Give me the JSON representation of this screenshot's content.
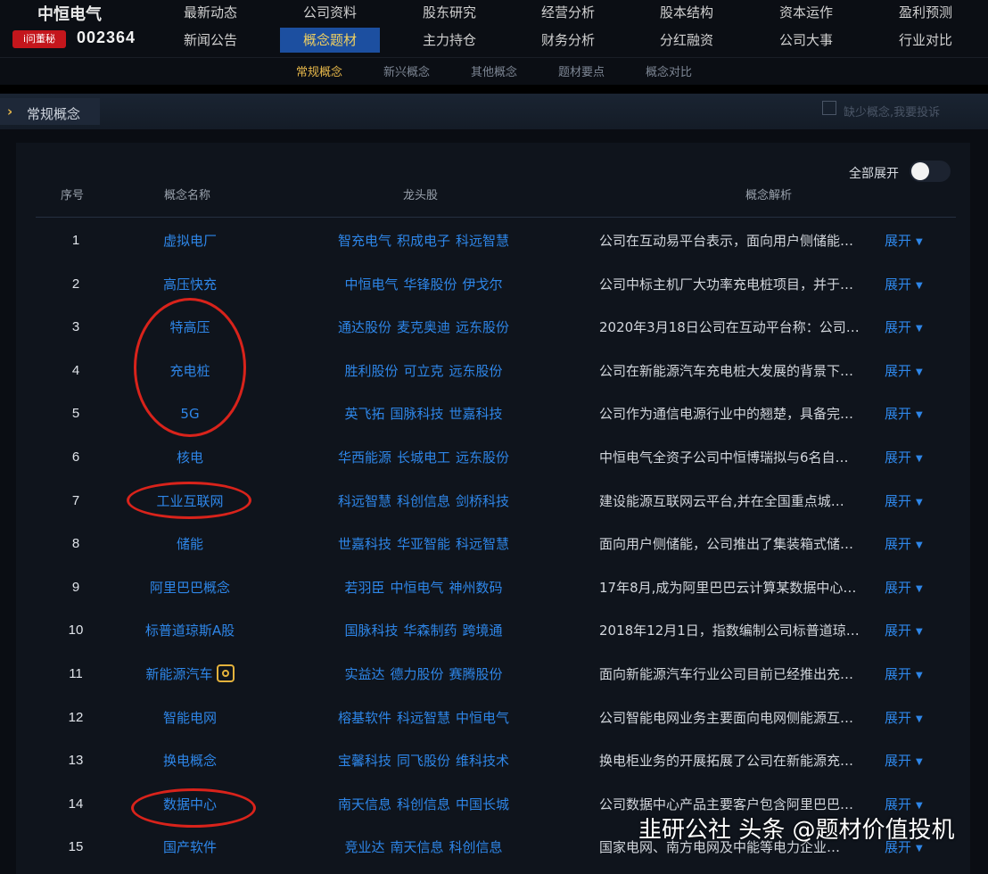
{
  "header": {
    "stock_name": "中恒电气",
    "badge": "i问董秘",
    "stock_code": "002364",
    "nav_row1": [
      "最新动态",
      "公司资料",
      "股东研究",
      "经营分析",
      "股本结构",
      "资本运作",
      "盈利预测"
    ],
    "nav_row2": [
      "新闻公告",
      "概念题材",
      "主力持仓",
      "财务分析",
      "分红融资",
      "公司大事",
      "行业对比"
    ],
    "active_nav": "概念题材"
  },
  "subnav": {
    "items": [
      "常规概念",
      "新兴概念",
      "其他概念",
      "题材要点",
      "概念对比"
    ],
    "active": "常规概念"
  },
  "section": {
    "title": "常规概念",
    "feedback": "缺少概念,我要投诉"
  },
  "table": {
    "expand_all_label": "全部展开",
    "headers": {
      "index": "序号",
      "name": "概念名称",
      "leaders": "龙头股",
      "analysis": "概念解析"
    },
    "expand_label": "展开",
    "rows": [
      {
        "idx": "1",
        "name": "虚拟电厂",
        "leaders": [
          "智充电气",
          "积成电子",
          "科远智慧"
        ],
        "desc": "公司在互动易平台表示，面向用户侧储能…"
      },
      {
        "idx": "2",
        "name": "高压快充",
        "leaders": [
          "中恒电气",
          "华锋股份",
          "伊戈尔"
        ],
        "desc": "公司中标主机厂大功率充电桩项目，并于…"
      },
      {
        "idx": "3",
        "name": "特高压",
        "leaders": [
          "通达股份",
          "麦克奥迪",
          "远东股份"
        ],
        "desc": "2020年3月18日公司在互动平台称：公司…"
      },
      {
        "idx": "4",
        "name": "充电桩",
        "leaders": [
          "胜利股份",
          "可立克",
          "远东股份"
        ],
        "desc": "公司在新能源汽车充电桩大发展的背景下…"
      },
      {
        "idx": "5",
        "name": "5G",
        "leaders": [
          "英飞拓",
          "国脉科技",
          "世嘉科技"
        ],
        "desc": "公司作为通信电源行业中的翘楚，具备完…"
      },
      {
        "idx": "6",
        "name": "核电",
        "leaders": [
          "华西能源",
          "长城电工",
          "远东股份"
        ],
        "desc": "中恒电气全资子公司中恒博瑞拟与6名自…"
      },
      {
        "idx": "7",
        "name": "工业互联网",
        "leaders": [
          "科远智慧",
          "科创信息",
          "剑桥科技"
        ],
        "desc": "建设能源互联网云平台,并在全国重点城…"
      },
      {
        "idx": "8",
        "name": "储能",
        "leaders": [
          "世嘉科技",
          "华亚智能",
          "科远智慧"
        ],
        "desc": "面向用户侧储能，公司推出了集装箱式储…"
      },
      {
        "idx": "9",
        "name": "阿里巴巴概念",
        "leaders": [
          "若羽臣",
          "中恒电气",
          "神州数码"
        ],
        "desc": "17年8月,成为阿里巴巴云计算某数据中心…"
      },
      {
        "idx": "10",
        "name": "标普道琼斯A股",
        "leaders": [
          "国脉科技",
          "华森制药",
          "跨境通"
        ],
        "desc": "2018年12月1日，指数编制公司标普道琼…"
      },
      {
        "idx": "11",
        "name": "新能源汽车",
        "leaders": [
          "实益达",
          "德力股份",
          "赛腾股份"
        ],
        "desc": "面向新能源汽车行业公司目前已经推出充…",
        "hot": true
      },
      {
        "idx": "12",
        "name": "智能电网",
        "leaders": [
          "榕基软件",
          "科远智慧",
          "中恒电气"
        ],
        "desc": "公司智能电网业务主要面向电网侧能源互…"
      },
      {
        "idx": "13",
        "name": "换电概念",
        "leaders": [
          "宝馨科技",
          "同飞股份",
          "维科技术"
        ],
        "desc": "换电柜业务的开展拓展了公司在新能源充…"
      },
      {
        "idx": "14",
        "name": "数据中心",
        "leaders": [
          "南天信息",
          "科创信息",
          "中国长城"
        ],
        "desc": "公司数据中心产品主要客户包含阿里巴巴…"
      },
      {
        "idx": "15",
        "name": "国产软件",
        "leaders": [
          "竞业达",
          "南天信息",
          "科创信息"
        ],
        "desc": "国家电网、南方电网及中能等电力企业…"
      }
    ]
  },
  "watermark": "韭研公社 头条 @题材价值投机",
  "colors": {
    "link": "#2e86e8",
    "accent": "#e6b74a",
    "active_nav_bg": "#1c4fa0",
    "highlight_ring": "#d9231b"
  }
}
